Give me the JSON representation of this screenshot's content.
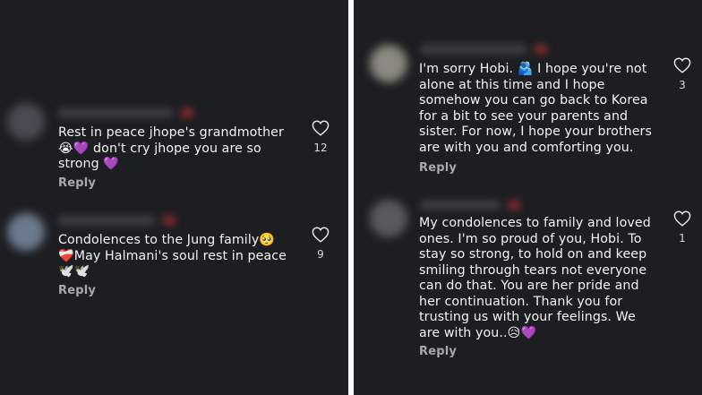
{
  "left_panel": {
    "comments": [
      {
        "lines": [
          "Rest in peace jhope's grandmother",
          "😭💜 don't cry jhope you are so",
          "strong 💜"
        ],
        "reply_label": "Reply",
        "like_count": "12",
        "avatar_color": "#4a4a52"
      },
      {
        "lines": [
          "Condolences to the Jung family🥺",
          "❤️‍🩹May Halmani's soul rest in peace",
          "🕊️🕊️"
        ],
        "reply_label": "Reply",
        "like_count": "9",
        "avatar_color": "#6b7a8c"
      }
    ]
  },
  "right_panel": {
    "comments": [
      {
        "lines": [
          "I'm sorry Hobi. 🫂 I hope you're not",
          "alone at this time and I hope",
          "somehow you can go back to Korea",
          "for a bit to see your parents and",
          "sister. For now, I hope your brothers",
          "are with you and comforting you."
        ],
        "reply_label": "Reply",
        "like_count": "3",
        "avatar_color": "#8a8a80"
      },
      {
        "lines": [
          "My condolences to family and loved",
          "ones. I'm so proud of you, Hobi. To",
          "stay so strong, to hold on and keep",
          "smiling through tears not everyone",
          "can do that. You are her pride and",
          "her continuation. Thank you for",
          "trusting us with your feelings. We",
          "are with you..😥💜"
        ],
        "reply_label": "Reply",
        "like_count": "1",
        "avatar_color": "#5a5a5e"
      }
    ]
  },
  "colors": {
    "background": "#1d1e21",
    "text": "#f4f4f4",
    "secondary_text": "#a8a9ad",
    "divider": "#ffffff"
  }
}
